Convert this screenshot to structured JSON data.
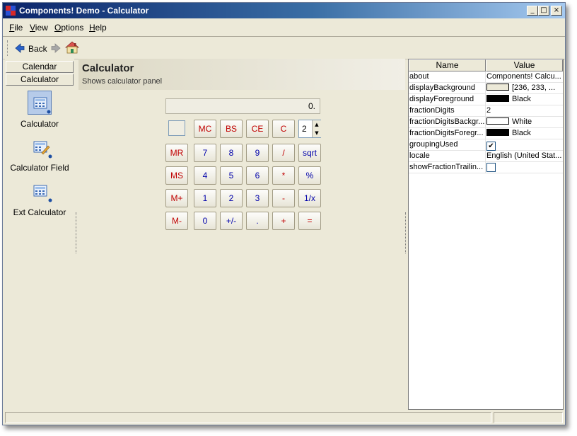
{
  "window": {
    "title": "Components! Demo - Calculator",
    "buttons": {
      "minimize": "_",
      "maximize": "□",
      "close": "×"
    }
  },
  "menu": [
    {
      "mnemonic": "F",
      "rest": "ile"
    },
    {
      "mnemonic": "V",
      "rest": "iew"
    },
    {
      "mnemonic": "O",
      "rest": "ptions"
    },
    {
      "mnemonic": "H",
      "rest": "elp"
    }
  ],
  "toolbar": {
    "back_label": "Back"
  },
  "sidebar": {
    "tabs": [
      "Calendar",
      "Calculator"
    ],
    "tools": [
      {
        "label": "Calculator",
        "icon": "calculator-icon",
        "selected": true
      },
      {
        "label": "Calculator Field",
        "icon": "calculator-field-icon",
        "selected": false
      },
      {
        "label": "Ext Calculator",
        "icon": "ext-calculator-icon",
        "selected": false
      }
    ]
  },
  "content": {
    "title": "Calculator",
    "subtitle": "Shows calculator panel"
  },
  "calculator": {
    "display": "0.",
    "fraction_digits": "2",
    "row1": [
      "MC",
      "BS",
      "CE",
      "C"
    ],
    "rows": [
      [
        "MR",
        "7",
        "8",
        "9",
        "/",
        "sqrt"
      ],
      [
        "MS",
        "4",
        "5",
        "6",
        "*",
        "%"
      ],
      [
        "M+",
        "1",
        "2",
        "3",
        "-",
        "1/x"
      ],
      [
        "M-",
        "0",
        "+/-",
        ".",
        "+",
        "="
      ]
    ]
  },
  "properties": {
    "headers": {
      "name": "Name",
      "value": "Value"
    },
    "rows": [
      {
        "name": "about",
        "value": "Components! Calcu..."
      },
      {
        "name": "displayBackground",
        "value": "[236, 233, ...",
        "swatch": "#ece9d8"
      },
      {
        "name": "displayForeground",
        "value": "Black",
        "swatch": "#000000"
      },
      {
        "name": "fractionDigits",
        "value": "2"
      },
      {
        "name": "fractionDigitsBackgr...",
        "value": "White",
        "swatch": "#ffffff"
      },
      {
        "name": "fractionDigitsForegr...",
        "value": "Black",
        "swatch": "#000000"
      },
      {
        "name": "groupingUsed",
        "checkbox": true,
        "checked": true
      },
      {
        "name": "locale",
        "value": "English (United Stat..."
      },
      {
        "name": "showFractionTrailin...",
        "checkbox": true,
        "checked": false
      }
    ]
  },
  "colors": {
    "memory_key": "#c00000",
    "digit_key": "#0000aa",
    "operator_key": "#c00000",
    "titlebar_start": "#0a246a",
    "titlebar_end": "#a6caf0"
  }
}
